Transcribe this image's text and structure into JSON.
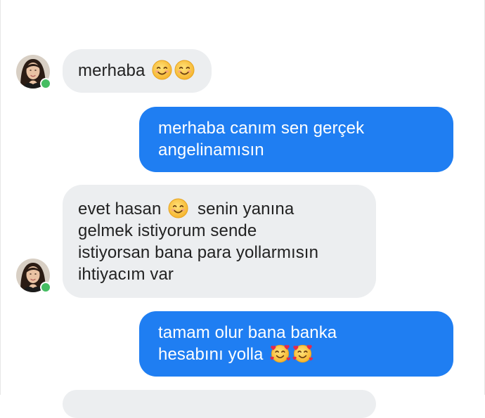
{
  "conversation": {
    "messages": [
      {
        "sender": "contact",
        "text": "merhaba",
        "emojis": [
          "smiling-face-icon",
          "smiling-face-icon"
        ]
      },
      {
        "sender": "me",
        "lines": [
          "merhaba canım sen gerçek",
          "angelinamısın"
        ]
      },
      {
        "sender": "contact",
        "lines": [
          "evet hasan",
          "senin yanına",
          "gelmek istiyorum sende",
          "istiyorsan bana para yollarmısın",
          "ihtiyacım var"
        ],
        "emojis": [
          "smiling-face-icon"
        ]
      },
      {
        "sender": "me",
        "lines": [
          "tamam olur bana banka",
          "hesabını yolla"
        ],
        "emojis": [
          "smiling-face-with-hearts-icon",
          "smiling-face-with-hearts-icon"
        ]
      }
    ]
  },
  "colors": {
    "incoming_bubble": "#eceef0",
    "outgoing_bubble": "#1f7ef2",
    "online_indicator": "#45bd62"
  }
}
